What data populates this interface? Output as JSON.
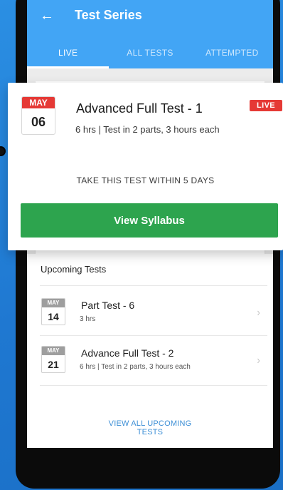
{
  "app": {
    "title": "Test Series",
    "tabs": [
      {
        "label": "LIVE",
        "active": true
      },
      {
        "label": "ALL TESTS",
        "active": false
      },
      {
        "label": "ATTEMPTED",
        "active": false
      }
    ]
  },
  "live_test": {
    "month": "MAY",
    "day": "06",
    "title": "Advanced Full Test - 1",
    "meta": "6 hrs  |  Test in 2 parts, 3 hours each",
    "badge": "LIVE",
    "notice": "TAKE THIS TEST WITHIN 5 DAYS",
    "button": "View Syllabus"
  },
  "upcoming": {
    "heading": "Upcoming Tests",
    "items": [
      {
        "month": "MAY",
        "day": "14",
        "title": "Part Test - 6",
        "meta": "3 hrs"
      },
      {
        "month": "MAY",
        "day": "21",
        "title": "Advance Full Test - 2",
        "meta": "6 hrs  |  Test in 2 parts, 3 hours each"
      }
    ],
    "view_all": "VIEW ALL UPCOMING\nTESTS"
  },
  "icons": {
    "back": "arrow-left-icon",
    "chevron": "chevron-right-icon"
  },
  "colors": {
    "primary": "#42a5f5",
    "live_red": "#e53935",
    "button_green": "#2da44e",
    "link_blue": "#3d8fd6"
  }
}
